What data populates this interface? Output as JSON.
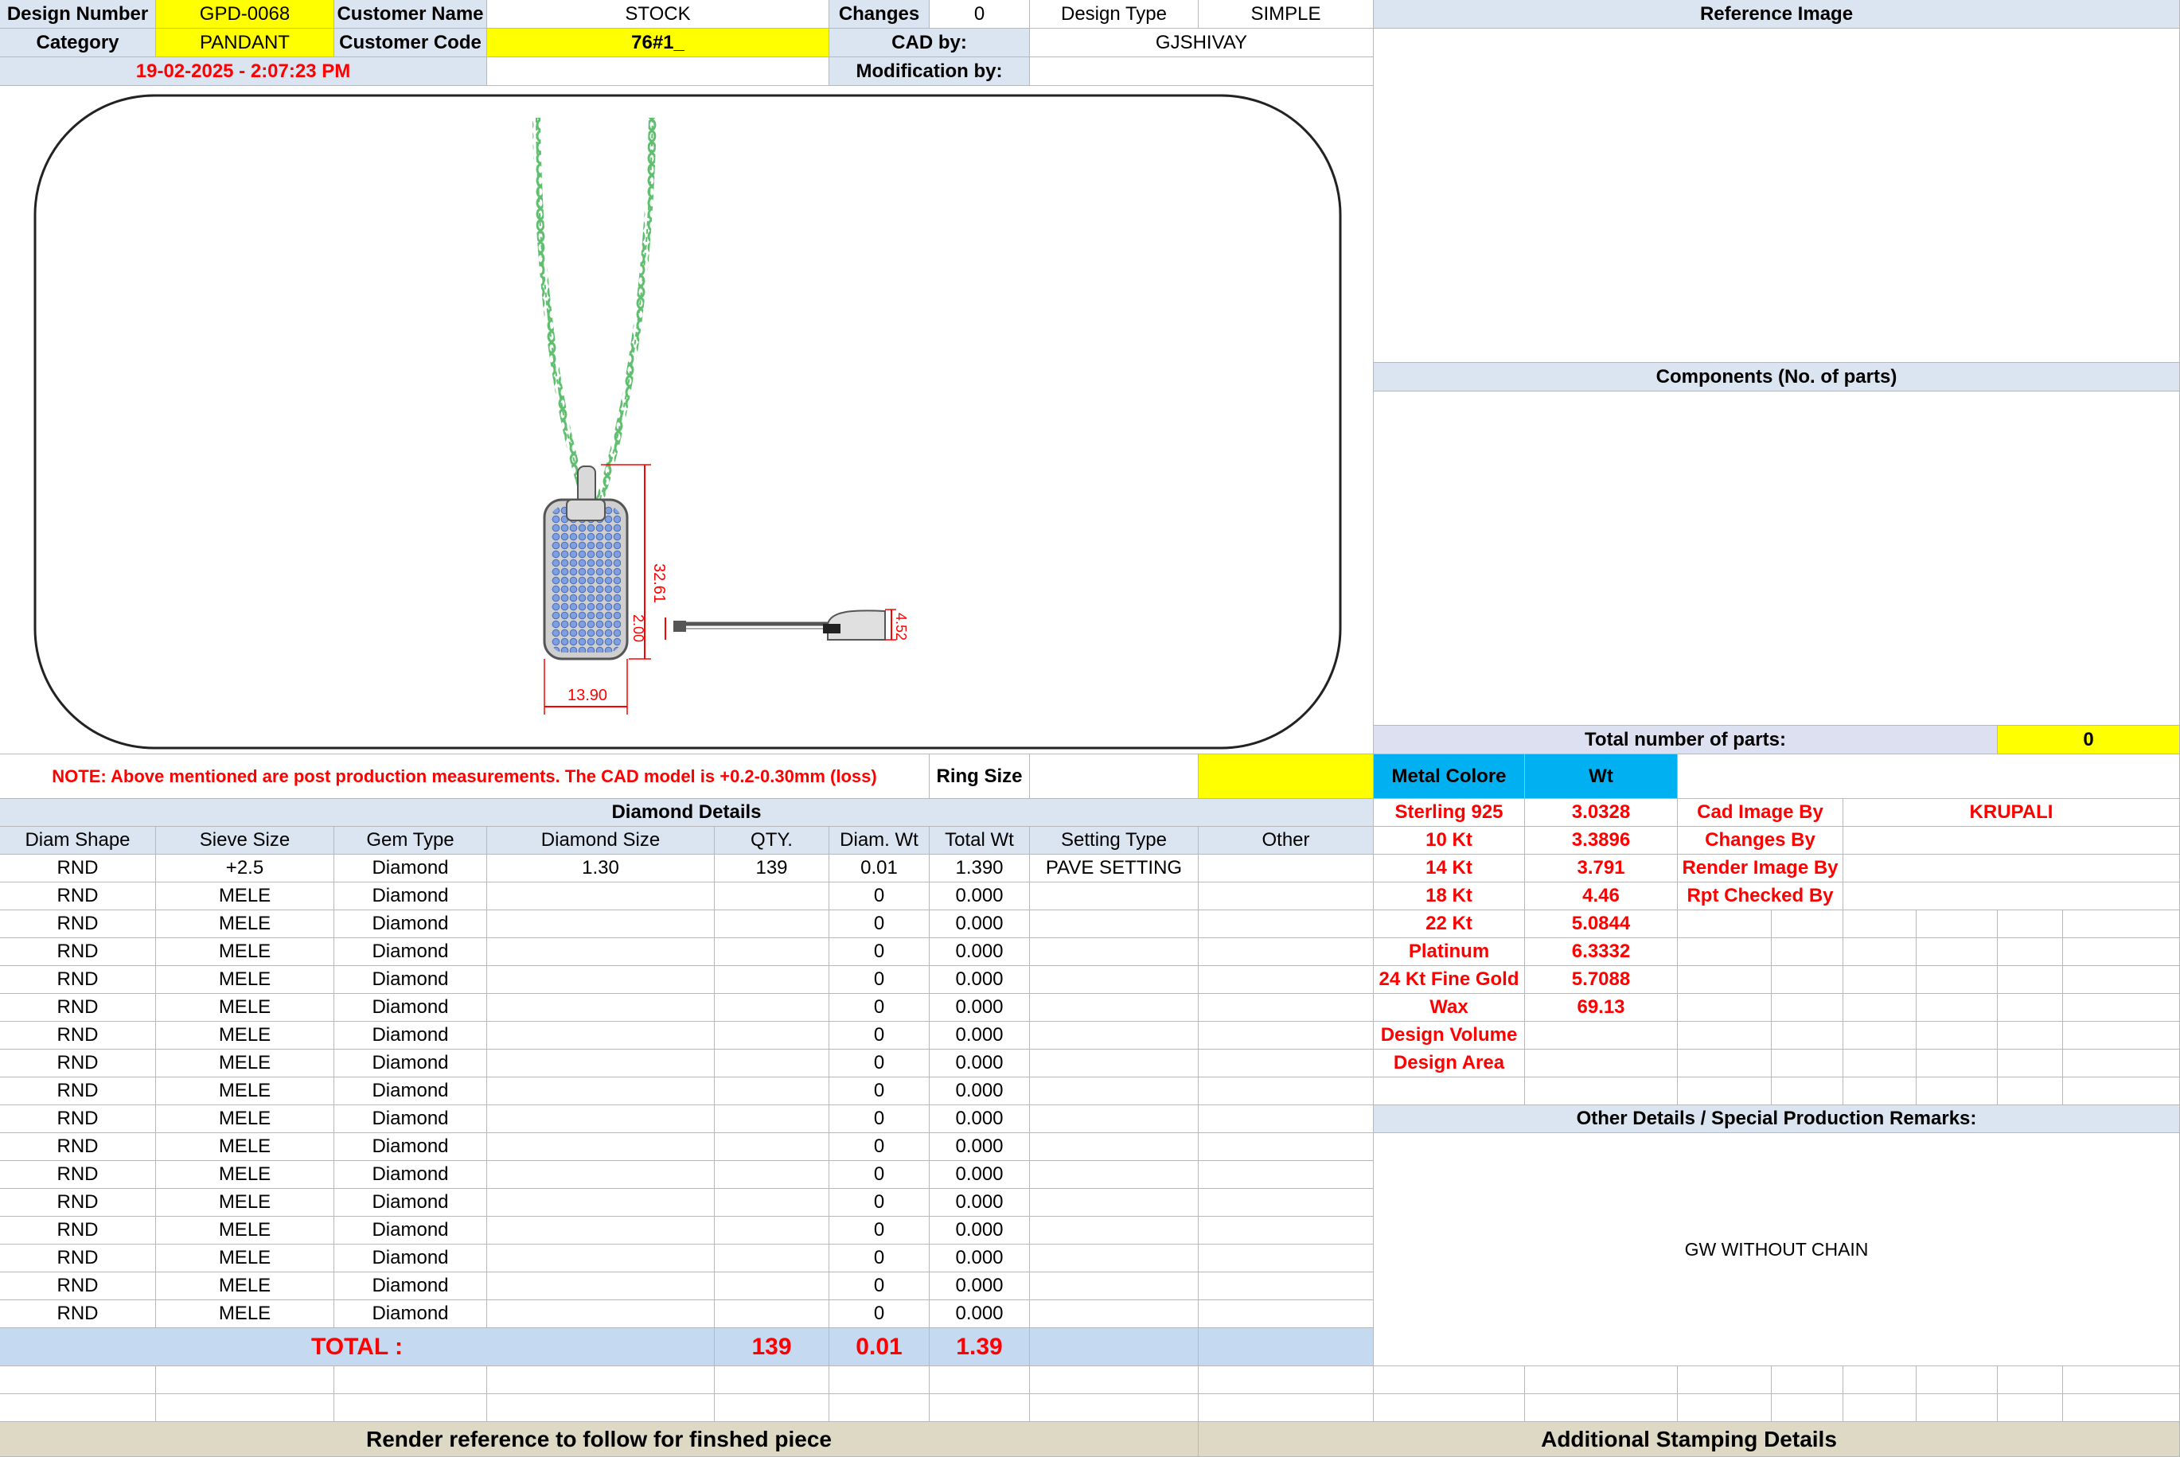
{
  "header": {
    "design_number_label": "Design Number",
    "design_number": "GPD-0068",
    "customer_name_label": "Customer Name",
    "customer_name": "STOCK",
    "changes_label": "Changes",
    "changes": "0",
    "design_type_label": "Design Type",
    "design_type": "SIMPLE",
    "reference_image_label": "Reference Image",
    "category_label": "Category",
    "category": "PANDANT",
    "customer_code_label": "Customer Code",
    "customer_code": "76#1_",
    "cad_by_label": "CAD by:",
    "cad_by": "GJSHIVAY",
    "datetime": "19-02-2025 - 2:07:23 PM",
    "modification_by_label": "Modification by:",
    "modification_by": ""
  },
  "cad_dimensions": {
    "height": "32.61",
    "width": "13.90",
    "thickness": "2.00",
    "side_height": "4.52"
  },
  "components": {
    "title": "Components (No. of parts)",
    "total_parts_label": "Total number of parts:",
    "total_parts": "0"
  },
  "note": {
    "text": "NOTE: Above mentioned are post production measurements. The CAD model is +0.2-0.30mm (loss)",
    "ring_size_label": "Ring Size",
    "ring_size": ""
  },
  "metal": {
    "color_label": "Metal Colore",
    "wt_label": "Wt",
    "rows": [
      {
        "name": "Sterling 925",
        "wt": "3.0328"
      },
      {
        "name": "10 Kt",
        "wt": "3.3896"
      },
      {
        "name": "14 Kt",
        "wt": "3.791"
      },
      {
        "name": "18 Kt",
        "wt": "4.46"
      },
      {
        "name": "22 Kt",
        "wt": "5.0844"
      },
      {
        "name": "Platinum",
        "wt": "6.3332"
      },
      {
        "name": "24 Kt Fine Gold",
        "wt": "5.7088"
      },
      {
        "name": "Wax",
        "wt": "69.13"
      },
      {
        "name": "Design Volume",
        "wt": ""
      },
      {
        "name": "Design Area",
        "wt": ""
      }
    ]
  },
  "credits": {
    "cad_image_by_label": "Cad Image By",
    "cad_image_by": "KRUPALI",
    "changes_by_label": "Changes By",
    "render_image_by_label": "Render Image By",
    "rpt_checked_by_label": "Rpt Checked By"
  },
  "diamond": {
    "title": "Diamond Details",
    "columns": [
      "Diam Shape",
      "Sieve Size",
      "Gem Type",
      "Diamond Size",
      "QTY.",
      "Diam. Wt",
      "Total Wt",
      "Setting Type",
      "Other"
    ],
    "rows": [
      [
        "RND",
        "+2.5",
        "Diamond",
        "1.30",
        "139",
        "0.01",
        "1.390",
        "PAVE SETTING",
        ""
      ],
      [
        "RND",
        "MELE",
        "Diamond",
        "",
        "",
        "0",
        "0.000",
        "",
        ""
      ],
      [
        "RND",
        "MELE",
        "Diamond",
        "",
        "",
        "0",
        "0.000",
        "",
        ""
      ],
      [
        "RND",
        "MELE",
        "Diamond",
        "",
        "",
        "0",
        "0.000",
        "",
        ""
      ],
      [
        "RND",
        "MELE",
        "Diamond",
        "",
        "",
        "0",
        "0.000",
        "",
        ""
      ],
      [
        "RND",
        "MELE",
        "Diamond",
        "",
        "",
        "0",
        "0.000",
        "",
        ""
      ],
      [
        "RND",
        "MELE",
        "Diamond",
        "",
        "",
        "0",
        "0.000",
        "",
        ""
      ],
      [
        "RND",
        "MELE",
        "Diamond",
        "",
        "",
        "0",
        "0.000",
        "",
        ""
      ],
      [
        "RND",
        "MELE",
        "Diamond",
        "",
        "",
        "0",
        "0.000",
        "",
        ""
      ],
      [
        "RND",
        "MELE",
        "Diamond",
        "",
        "",
        "0",
        "0.000",
        "",
        ""
      ],
      [
        "RND",
        "MELE",
        "Diamond",
        "",
        "",
        "0",
        "0.000",
        "",
        ""
      ],
      [
        "RND",
        "MELE",
        "Diamond",
        "",
        "",
        "0",
        "0.000",
        "",
        ""
      ],
      [
        "RND",
        "MELE",
        "Diamond",
        "",
        "",
        "0",
        "0.000",
        "",
        ""
      ],
      [
        "RND",
        "MELE",
        "Diamond",
        "",
        "",
        "0",
        "0.000",
        "",
        ""
      ],
      [
        "RND",
        "MELE",
        "Diamond",
        "",
        "",
        "0",
        "0.000",
        "",
        ""
      ],
      [
        "RND",
        "MELE",
        "Diamond",
        "",
        "",
        "0",
        "0.000",
        "",
        ""
      ],
      [
        "RND",
        "MELE",
        "Diamond",
        "",
        "",
        "0",
        "0.000",
        "",
        ""
      ]
    ],
    "total_label": "TOTAL :",
    "total_qty": "139",
    "total_diam_wt": "0.01",
    "total_wt": "1.39"
  },
  "remarks": {
    "title": "Other Details / Special Production Remarks:",
    "text": "GW WITHOUT CHAIN"
  },
  "footer": {
    "render_reference": "Render reference to follow for finshed piece",
    "additional_stamping": "Additional Stamping Details"
  },
  "colors": {
    "header_blue": "#dbe5f1",
    "highlight_yellow": "#ffff00",
    "metal_cyan": "#00b0f0",
    "footer_tan": "#ddd9c4",
    "total_blue": "#c5d9f1",
    "alert_red": "#ff0000",
    "chain_green": "#5fbf6f",
    "pave_blue": "#7e9fe0"
  }
}
